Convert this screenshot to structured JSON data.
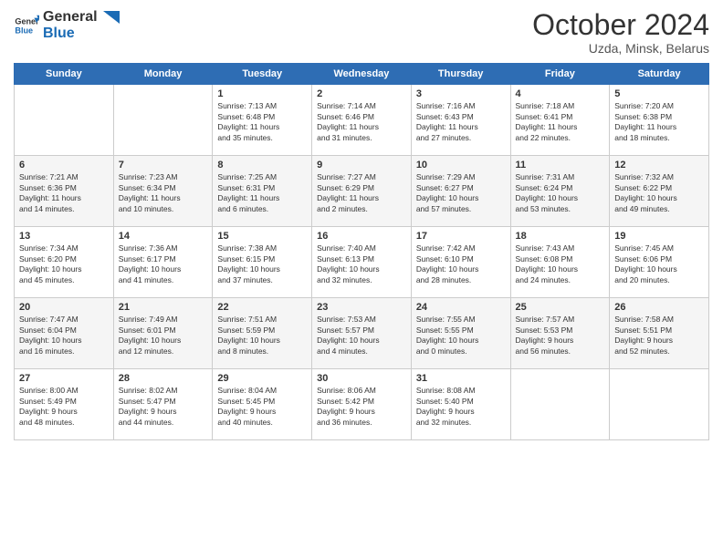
{
  "logo": {
    "line1": "General",
    "line2": "Blue"
  },
  "title": "October 2024",
  "subtitle": "Uzda, Minsk, Belarus",
  "days_header": [
    "Sunday",
    "Monday",
    "Tuesday",
    "Wednesday",
    "Thursday",
    "Friday",
    "Saturday"
  ],
  "weeks": [
    [
      {
        "num": "",
        "detail": ""
      },
      {
        "num": "",
        "detail": ""
      },
      {
        "num": "1",
        "detail": "Sunrise: 7:13 AM\nSunset: 6:48 PM\nDaylight: 11 hours\nand 35 minutes."
      },
      {
        "num": "2",
        "detail": "Sunrise: 7:14 AM\nSunset: 6:46 PM\nDaylight: 11 hours\nand 31 minutes."
      },
      {
        "num": "3",
        "detail": "Sunrise: 7:16 AM\nSunset: 6:43 PM\nDaylight: 11 hours\nand 27 minutes."
      },
      {
        "num": "4",
        "detail": "Sunrise: 7:18 AM\nSunset: 6:41 PM\nDaylight: 11 hours\nand 22 minutes."
      },
      {
        "num": "5",
        "detail": "Sunrise: 7:20 AM\nSunset: 6:38 PM\nDaylight: 11 hours\nand 18 minutes."
      }
    ],
    [
      {
        "num": "6",
        "detail": "Sunrise: 7:21 AM\nSunset: 6:36 PM\nDaylight: 11 hours\nand 14 minutes."
      },
      {
        "num": "7",
        "detail": "Sunrise: 7:23 AM\nSunset: 6:34 PM\nDaylight: 11 hours\nand 10 minutes."
      },
      {
        "num": "8",
        "detail": "Sunrise: 7:25 AM\nSunset: 6:31 PM\nDaylight: 11 hours\nand 6 minutes."
      },
      {
        "num": "9",
        "detail": "Sunrise: 7:27 AM\nSunset: 6:29 PM\nDaylight: 11 hours\nand 2 minutes."
      },
      {
        "num": "10",
        "detail": "Sunrise: 7:29 AM\nSunset: 6:27 PM\nDaylight: 10 hours\nand 57 minutes."
      },
      {
        "num": "11",
        "detail": "Sunrise: 7:31 AM\nSunset: 6:24 PM\nDaylight: 10 hours\nand 53 minutes."
      },
      {
        "num": "12",
        "detail": "Sunrise: 7:32 AM\nSunset: 6:22 PM\nDaylight: 10 hours\nand 49 minutes."
      }
    ],
    [
      {
        "num": "13",
        "detail": "Sunrise: 7:34 AM\nSunset: 6:20 PM\nDaylight: 10 hours\nand 45 minutes."
      },
      {
        "num": "14",
        "detail": "Sunrise: 7:36 AM\nSunset: 6:17 PM\nDaylight: 10 hours\nand 41 minutes."
      },
      {
        "num": "15",
        "detail": "Sunrise: 7:38 AM\nSunset: 6:15 PM\nDaylight: 10 hours\nand 37 minutes."
      },
      {
        "num": "16",
        "detail": "Sunrise: 7:40 AM\nSunset: 6:13 PM\nDaylight: 10 hours\nand 32 minutes."
      },
      {
        "num": "17",
        "detail": "Sunrise: 7:42 AM\nSunset: 6:10 PM\nDaylight: 10 hours\nand 28 minutes."
      },
      {
        "num": "18",
        "detail": "Sunrise: 7:43 AM\nSunset: 6:08 PM\nDaylight: 10 hours\nand 24 minutes."
      },
      {
        "num": "19",
        "detail": "Sunrise: 7:45 AM\nSunset: 6:06 PM\nDaylight: 10 hours\nand 20 minutes."
      }
    ],
    [
      {
        "num": "20",
        "detail": "Sunrise: 7:47 AM\nSunset: 6:04 PM\nDaylight: 10 hours\nand 16 minutes."
      },
      {
        "num": "21",
        "detail": "Sunrise: 7:49 AM\nSunset: 6:01 PM\nDaylight: 10 hours\nand 12 minutes."
      },
      {
        "num": "22",
        "detail": "Sunrise: 7:51 AM\nSunset: 5:59 PM\nDaylight: 10 hours\nand 8 minutes."
      },
      {
        "num": "23",
        "detail": "Sunrise: 7:53 AM\nSunset: 5:57 PM\nDaylight: 10 hours\nand 4 minutes."
      },
      {
        "num": "24",
        "detail": "Sunrise: 7:55 AM\nSunset: 5:55 PM\nDaylight: 10 hours\nand 0 minutes."
      },
      {
        "num": "25",
        "detail": "Sunrise: 7:57 AM\nSunset: 5:53 PM\nDaylight: 9 hours\nand 56 minutes."
      },
      {
        "num": "26",
        "detail": "Sunrise: 7:58 AM\nSunset: 5:51 PM\nDaylight: 9 hours\nand 52 minutes."
      }
    ],
    [
      {
        "num": "27",
        "detail": "Sunrise: 8:00 AM\nSunset: 5:49 PM\nDaylight: 9 hours\nand 48 minutes."
      },
      {
        "num": "28",
        "detail": "Sunrise: 8:02 AM\nSunset: 5:47 PM\nDaylight: 9 hours\nand 44 minutes."
      },
      {
        "num": "29",
        "detail": "Sunrise: 8:04 AM\nSunset: 5:45 PM\nDaylight: 9 hours\nand 40 minutes."
      },
      {
        "num": "30",
        "detail": "Sunrise: 8:06 AM\nSunset: 5:42 PM\nDaylight: 9 hours\nand 36 minutes."
      },
      {
        "num": "31",
        "detail": "Sunrise: 8:08 AM\nSunset: 5:40 PM\nDaylight: 9 hours\nand 32 minutes."
      },
      {
        "num": "",
        "detail": ""
      },
      {
        "num": "",
        "detail": ""
      }
    ]
  ]
}
